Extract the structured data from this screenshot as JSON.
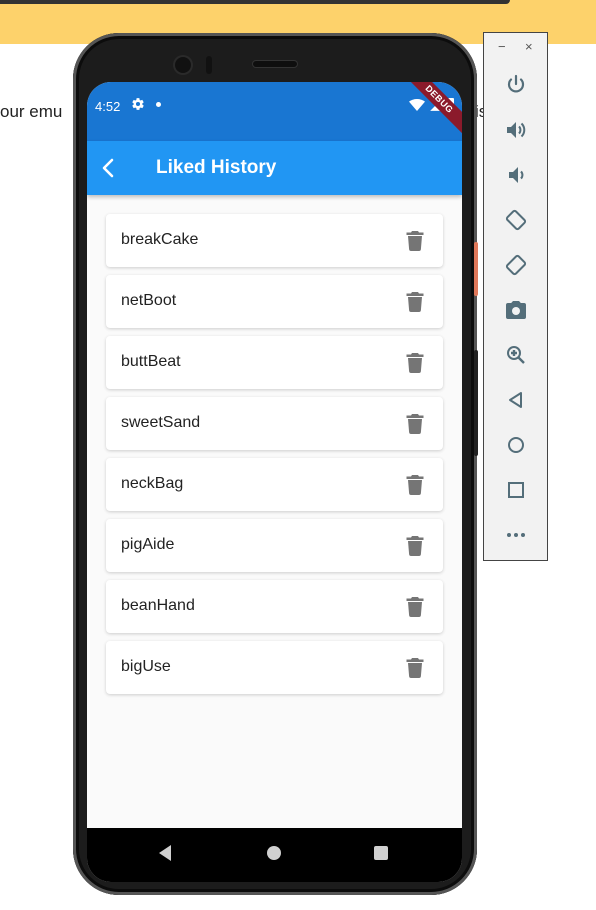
{
  "background": {
    "partial_text_left": "our emu",
    "partial_text_right": "is"
  },
  "status_bar": {
    "time": "4:52",
    "debug_banner": "DEBUG"
  },
  "app_bar": {
    "title": "Liked History",
    "back_icon": "arrow-back-icon"
  },
  "liked_items": [
    {
      "label": "breakCake"
    },
    {
      "label": "netBoot"
    },
    {
      "label": "buttBeat"
    },
    {
      "label": "sweetSand"
    },
    {
      "label": "neckBag"
    },
    {
      "label": "pigAide"
    },
    {
      "label": "beanHand"
    },
    {
      "label": "bigUse"
    }
  ],
  "emulator_toolbar": {
    "minimize": "−",
    "close": "×",
    "tools": [
      "power-icon",
      "volume-up-icon",
      "volume-down-icon",
      "rotate-left-icon",
      "rotate-right-icon",
      "camera-icon",
      "zoom-icon",
      "back-icon",
      "home-icon",
      "overview-icon",
      "more-icon"
    ]
  },
  "colors": {
    "app_bar": "#2196f3",
    "status_bar": "#1976d2",
    "banner": "#fdd26b",
    "trash_icon": "#757575"
  }
}
